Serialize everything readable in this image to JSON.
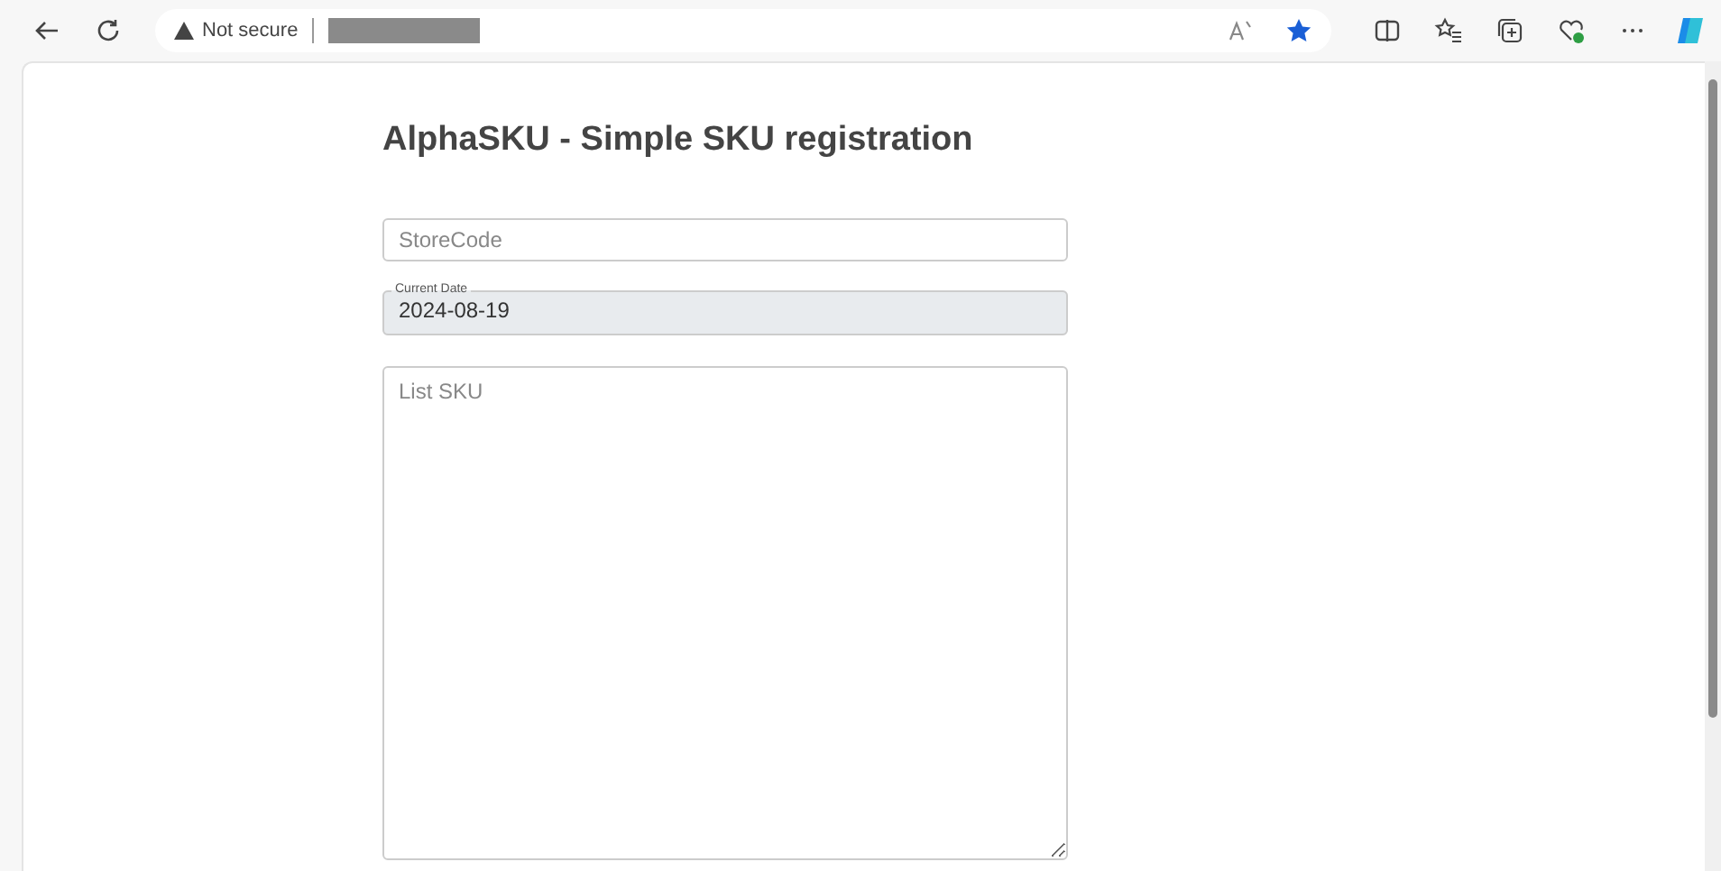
{
  "browser": {
    "security_label": "Not secure"
  },
  "page": {
    "title": "AlphaSKU - Simple SKU registration",
    "fields": [
      {
        "kind": "input",
        "placeholder": "StoreCode"
      },
      {
        "kind": "readonly",
        "label": "Current Date",
        "value": "2024-08-19"
      },
      {
        "kind": "textarea",
        "placeholder": "List SKU"
      }
    ]
  }
}
